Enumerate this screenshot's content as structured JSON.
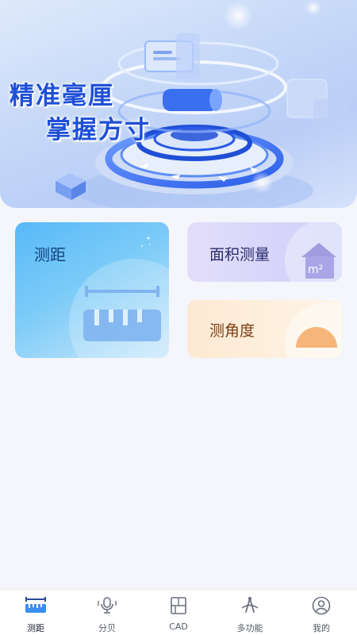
{
  "banner": {
    "slogan_line1": "精准毫厘",
    "slogan_line2": "掌握方寸"
  },
  "cards": {
    "distance": {
      "label": "测距",
      "icon": "ruler-icon"
    },
    "area": {
      "label": "面积测量",
      "icon": "house-m2-icon",
      "icon_text": "m²"
    },
    "angle": {
      "label": "测角度",
      "icon": "half-sun-icon"
    }
  },
  "nav": {
    "items": [
      {
        "label": "测距",
        "icon": "ruler-icon",
        "active": true
      },
      {
        "label": "分贝",
        "icon": "microphone-icon",
        "active": false
      },
      {
        "label": "CAD",
        "icon": "floorplan-icon",
        "active": false
      },
      {
        "label": "多功能",
        "icon": "multi-tool-icon",
        "active": false
      },
      {
        "label": "我的",
        "icon": "profile-icon",
        "active": false
      }
    ]
  },
  "colors": {
    "accent": "#1f4fd6",
    "background": "#f4f6fb",
    "distance_card": "#58b9f7",
    "area_card": "#d6d4fa",
    "angle_card": "#fde9d2"
  }
}
